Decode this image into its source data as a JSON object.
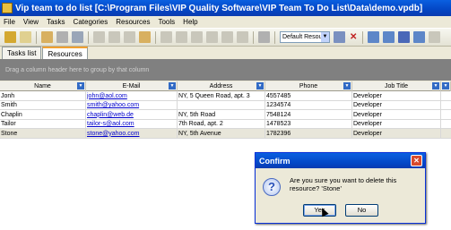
{
  "window": {
    "title": "Vip team to do list [C:\\Program Files\\VIP Quality Software\\VIP Team To Do List\\Data\\demo.vpdb]"
  },
  "menu": [
    "File",
    "View",
    "Tasks",
    "Categories",
    "Resources",
    "Tools",
    "Help"
  ],
  "toolbar": {
    "resource_select_value": "Default Resou",
    "delete_symbol": "✕"
  },
  "tabs": [
    {
      "label": "Tasks list",
      "active": false
    },
    {
      "label": "Resources",
      "active": true
    }
  ],
  "group_area": {
    "text": "Drag a column header here to group by that column"
  },
  "grid": {
    "columns": [
      "Name",
      "E-Mail",
      "Address",
      "Phone",
      "Job Title"
    ],
    "rows": [
      {
        "name": "Jonh",
        "email": "john@aol.com",
        "address": "NY, 5 Queen Road, apt. 3",
        "phone": "4557485",
        "job": "Developer"
      },
      {
        "name": "Smith",
        "email": "smith@yahoo.com",
        "address": "",
        "phone": "1234574",
        "job": "Developer"
      },
      {
        "name": "Chaplin",
        "email": "chaplin@web.de",
        "address": "NY, 5th Road",
        "phone": "7548124",
        "job": "Developer"
      },
      {
        "name": "Tailor",
        "email": "tailor-s@aol.com",
        "address": "7th Road, apt. 2",
        "phone": "1478523",
        "job": "Developer"
      },
      {
        "name": "Stone",
        "email": "stone@yahoo.com",
        "address": "NY, 5th Avenue",
        "phone": "1782396",
        "job": "Developer",
        "selected": true
      }
    ]
  },
  "dialog": {
    "title": "Confirm",
    "close_symbol": "✕",
    "icon_symbol": "?",
    "message": "Are you sure you want to delete this resource? 'Stone'",
    "yes_label": "Yes",
    "no_label": "No"
  }
}
